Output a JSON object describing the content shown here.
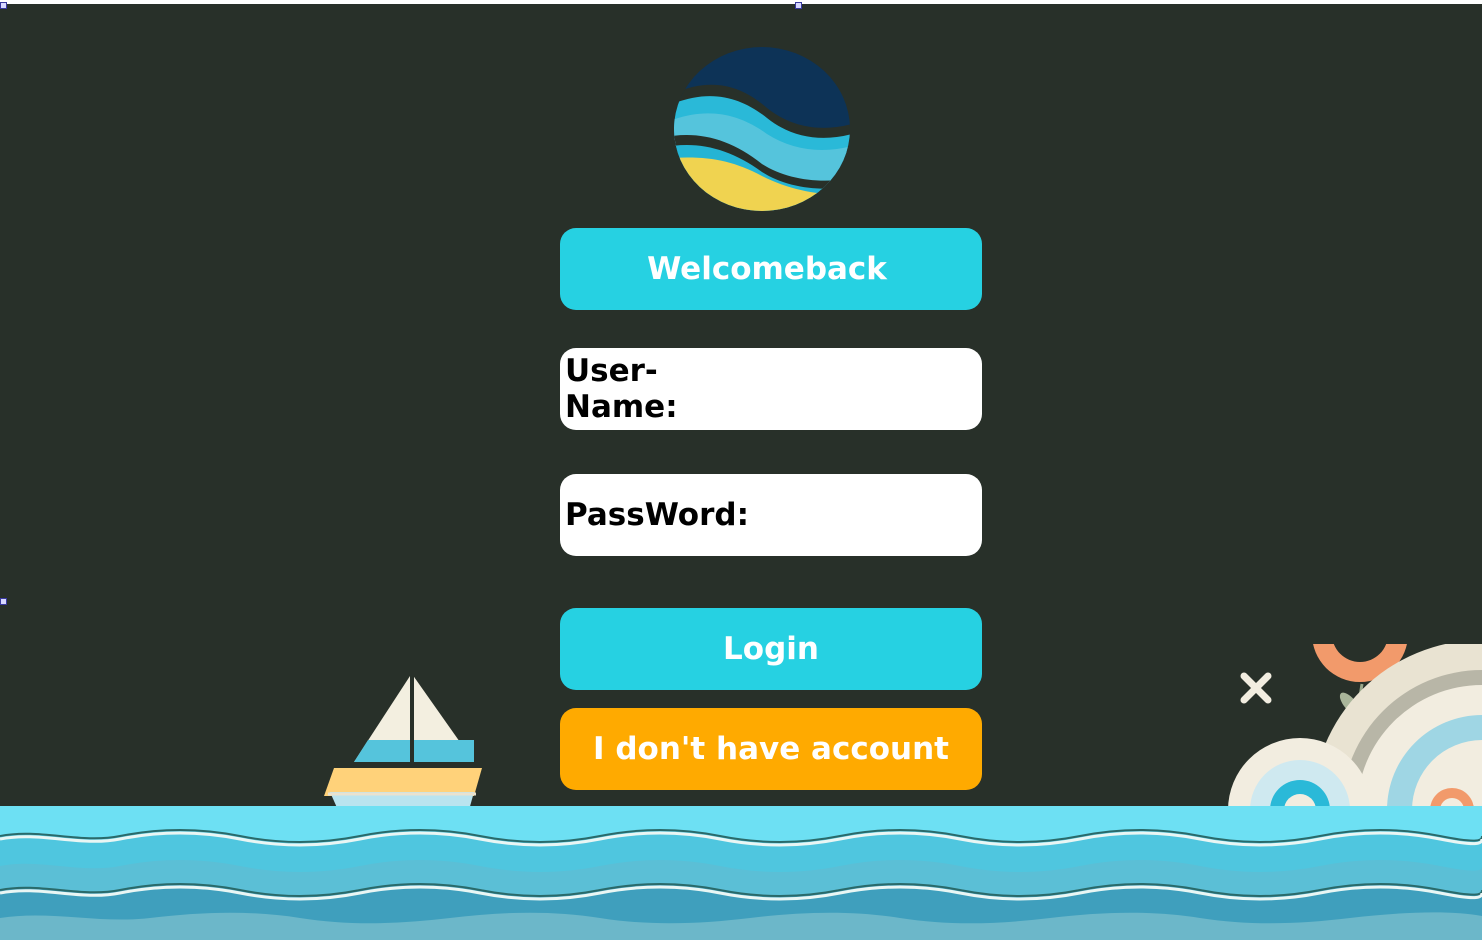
{
  "app": {
    "heading": "Welcomeback"
  },
  "form": {
    "username_label": "User-Name:",
    "username_value": "",
    "password_label": "PassWord:",
    "password_value": ""
  },
  "actions": {
    "login_label": "Login",
    "signup_label": "I don't have account"
  },
  "colors": {
    "background": "#283029",
    "accent": "#26d1e2",
    "secondary": "#ffaa00",
    "field": "#ffffff"
  },
  "icons": [
    "logo-icon",
    "sailboat-icon",
    "close-icon",
    "sea-waves-icon",
    "broken-image-icon"
  ]
}
